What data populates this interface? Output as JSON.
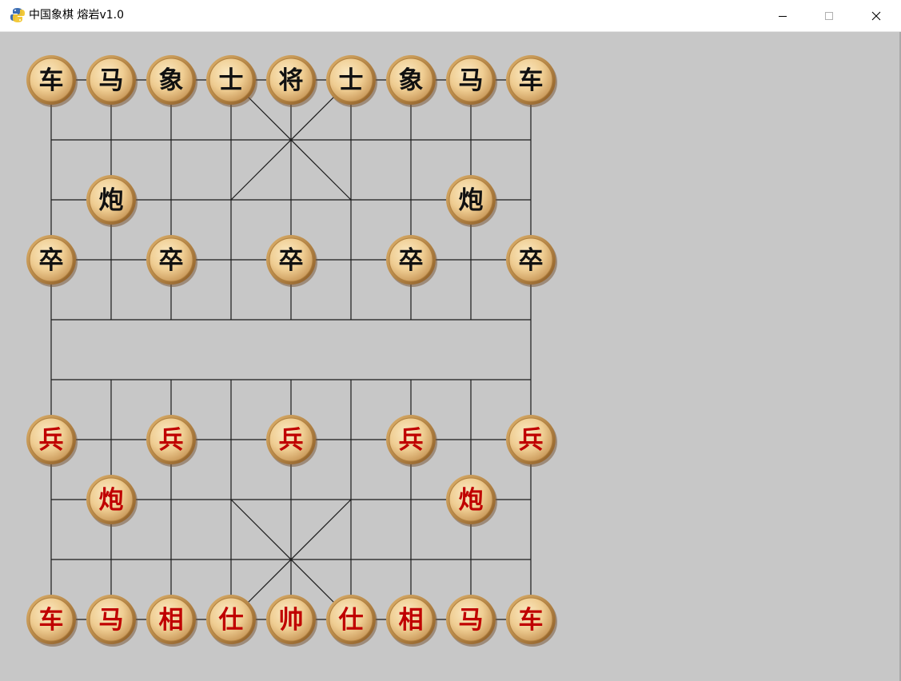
{
  "window": {
    "title": "中国象棋 熔岩v1.0",
    "icon": "python-snake-icon",
    "controls": [
      "minimize",
      "maximize",
      "close"
    ]
  },
  "board": {
    "files": 9,
    "ranks": 10,
    "background_color": "#c7c7c7",
    "line_color": "#1a1a1a",
    "black_piece_color": "#111111",
    "red_piece_color": "#c00000",
    "pieces": [
      {
        "side": "black",
        "char": "车",
        "col": 0,
        "row": 0
      },
      {
        "side": "black",
        "char": "马",
        "col": 1,
        "row": 0
      },
      {
        "side": "black",
        "char": "象",
        "col": 2,
        "row": 0
      },
      {
        "side": "black",
        "char": "士",
        "col": 3,
        "row": 0
      },
      {
        "side": "black",
        "char": "将",
        "col": 4,
        "row": 0
      },
      {
        "side": "black",
        "char": "士",
        "col": 5,
        "row": 0
      },
      {
        "side": "black",
        "char": "象",
        "col": 6,
        "row": 0
      },
      {
        "side": "black",
        "char": "马",
        "col": 7,
        "row": 0
      },
      {
        "side": "black",
        "char": "车",
        "col": 8,
        "row": 0
      },
      {
        "side": "black",
        "char": "炮",
        "col": 1,
        "row": 2
      },
      {
        "side": "black",
        "char": "炮",
        "col": 7,
        "row": 2
      },
      {
        "side": "black",
        "char": "卒",
        "col": 0,
        "row": 3
      },
      {
        "side": "black",
        "char": "卒",
        "col": 2,
        "row": 3
      },
      {
        "side": "black",
        "char": "卒",
        "col": 4,
        "row": 3
      },
      {
        "side": "black",
        "char": "卒",
        "col": 6,
        "row": 3
      },
      {
        "side": "black",
        "char": "卒",
        "col": 8,
        "row": 3
      },
      {
        "side": "red",
        "char": "兵",
        "col": 0,
        "row": 6
      },
      {
        "side": "red",
        "char": "兵",
        "col": 2,
        "row": 6
      },
      {
        "side": "red",
        "char": "兵",
        "col": 4,
        "row": 6
      },
      {
        "side": "red",
        "char": "兵",
        "col": 6,
        "row": 6
      },
      {
        "side": "red",
        "char": "兵",
        "col": 8,
        "row": 6
      },
      {
        "side": "red",
        "char": "炮",
        "col": 1,
        "row": 7
      },
      {
        "side": "red",
        "char": "炮",
        "col": 7,
        "row": 7
      },
      {
        "side": "red",
        "char": "车",
        "col": 0,
        "row": 9
      },
      {
        "side": "red",
        "char": "马",
        "col": 1,
        "row": 9
      },
      {
        "side": "red",
        "char": "相",
        "col": 2,
        "row": 9
      },
      {
        "side": "red",
        "char": "仕",
        "col": 3,
        "row": 9
      },
      {
        "side": "red",
        "char": "帅",
        "col": 4,
        "row": 9
      },
      {
        "side": "red",
        "char": "仕",
        "col": 5,
        "row": 9
      },
      {
        "side": "red",
        "char": "相",
        "col": 6,
        "row": 9
      },
      {
        "side": "red",
        "char": "马",
        "col": 7,
        "row": 9
      },
      {
        "side": "red",
        "char": "车",
        "col": 8,
        "row": 9
      }
    ]
  }
}
